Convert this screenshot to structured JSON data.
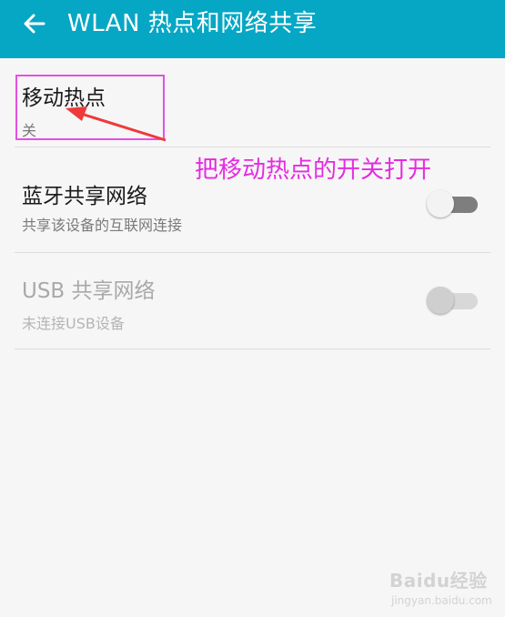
{
  "header": {
    "title": "WLAN 热点和网络共享",
    "back_icon": "arrow-left-icon",
    "background_color": "#05a7c4"
  },
  "settings": [
    {
      "title": "移动热点",
      "subtitle": "关",
      "enabled": true
    },
    {
      "title": "蓝牙共享网络",
      "subtitle": "共享该设备的互联网连接",
      "enabled": true,
      "switch_on": false
    },
    {
      "title": "USB 共享网络",
      "subtitle": "未连接USB设备",
      "enabled": false,
      "switch_on": false
    }
  ],
  "annotation": {
    "text": "把移动热点的开关打开",
    "color": "#e52be0"
  },
  "watermark": {
    "brand": "Baidu经验",
    "domain": "jingyan.baidu.com"
  }
}
